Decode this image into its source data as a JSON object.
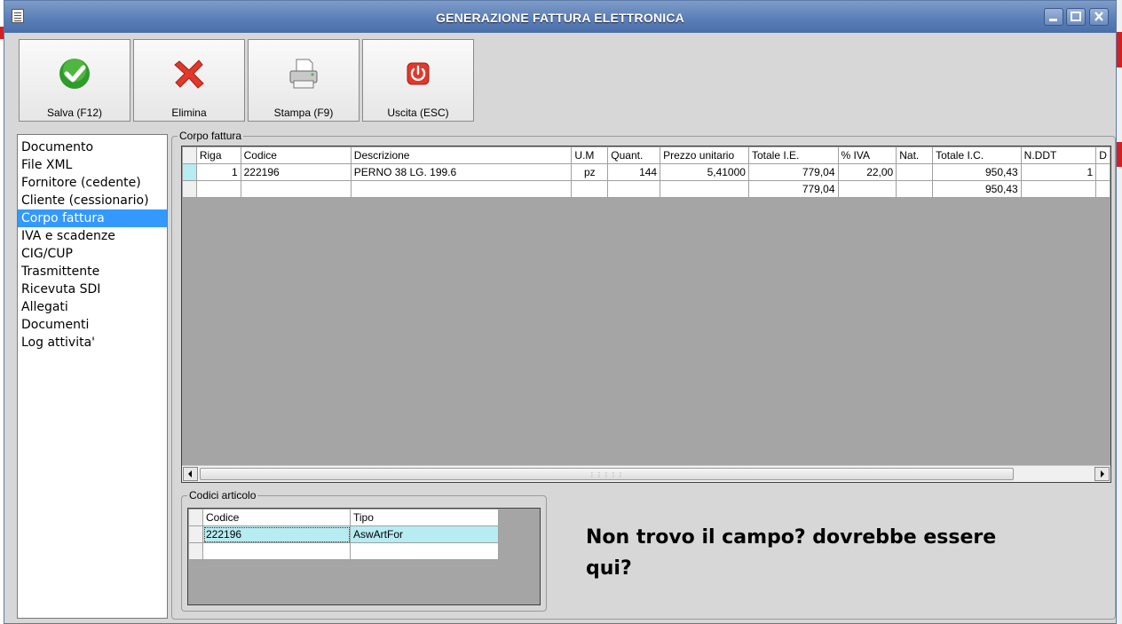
{
  "window": {
    "title": "GENERAZIONE FATTURA ELETTRONICA",
    "controls": [
      "minimize",
      "maximize",
      "close"
    ]
  },
  "toolbar": {
    "buttons": [
      {
        "label": "Salva (F12)",
        "icon": "check-icon"
      },
      {
        "label": "Elimina",
        "icon": "delete-x-icon"
      },
      {
        "label": "Stampa (F9)",
        "icon": "printer-icon"
      },
      {
        "label": "Uscita (ESC)",
        "icon": "power-icon"
      }
    ]
  },
  "nav": {
    "items": [
      "Documento",
      "File XML",
      "Fornitore (cedente)",
      "Cliente (cessionario)",
      "Corpo fattura",
      "IVA e scadenze",
      "CIG/CUP",
      "Trasmittente",
      "Ricevuta SDI",
      "Allegati",
      "Documenti",
      "Log attivita'"
    ],
    "selected": "Corpo fattura"
  },
  "corpo": {
    "legend": "Corpo fattura",
    "columns": [
      "Riga",
      "Codice",
      "Descrizione",
      "U.M",
      "Quant.",
      "Prezzo unitario",
      "Totale I.E.",
      "% IVA",
      "Nat.",
      "Totale I.C.",
      "N.DDT",
      "D"
    ],
    "rows": [
      [
        "1",
        "222196",
        "PERNO 38 LG. 199.6",
        "pz",
        "144",
        "5,41000",
        "779,04",
        "22,00",
        "",
        "950,43",
        "1",
        ""
      ]
    ],
    "totals": [
      "",
      "",
      "",
      "",
      "",
      "",
      "779,04",
      "",
      "",
      "950,43",
      "",
      ""
    ]
  },
  "codici": {
    "legend": "Codici articolo",
    "columns": [
      "Codice",
      "Tipo"
    ],
    "rows": [
      [
        "222196",
        "AswArtFor"
      ],
      [
        "",
        ""
      ]
    ]
  },
  "note": {
    "line1": "Non trovo il campo? dovrebbe essere",
    "line2": "qui?"
  },
  "colors": {
    "titlebar": "#5b7fb8",
    "selection": "#3399ff",
    "highlight_row": "#b6ecf2",
    "grid_empty": "#a5a5a5"
  }
}
